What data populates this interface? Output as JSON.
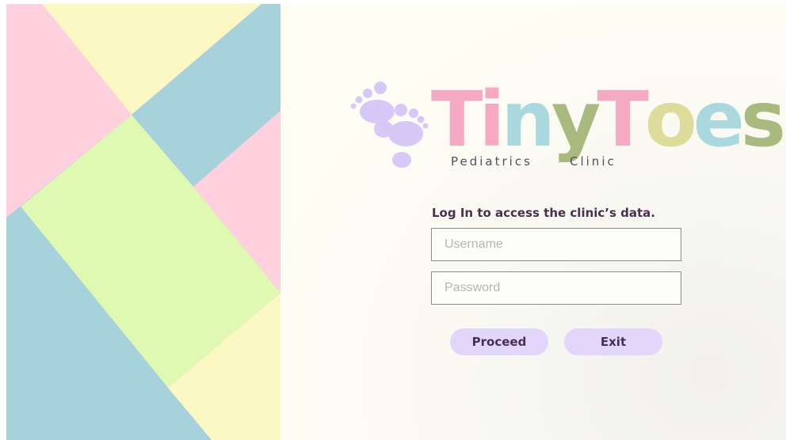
{
  "brand": {
    "title_letters": [
      {
        "char": "T",
        "color": "#f6a9c3"
      },
      {
        "char": "i",
        "color": "#f6a9c3"
      },
      {
        "char": "n",
        "color": "#a9d8df"
      },
      {
        "char": "y",
        "color": "#a8ba7e"
      },
      {
        "char": "T",
        "color": "#f6a9c3"
      },
      {
        "char": "o",
        "color": "#dedc9a"
      },
      {
        "char": "e",
        "color": "#a9d8df"
      },
      {
        "char": "s",
        "color": "#a8ba7e"
      }
    ],
    "subtitle_left": "Pediatrics",
    "subtitle_right": "Clinic",
    "footprint_color": "#d8c8f7"
  },
  "login": {
    "heading": "Log In to access the clinic’s data.",
    "username_placeholder": "Username",
    "username_value": "",
    "password_placeholder": "Password",
    "password_value": "",
    "proceed_label": "Proceed",
    "exit_label": "Exit"
  },
  "theme": {
    "pink": "#ffd0dd",
    "yellow": "#fbf8c3",
    "blue": "#a8d2db",
    "green": "#dff9b3",
    "button": "#e3d6fb",
    "text_dark": "#4a2f4f"
  }
}
